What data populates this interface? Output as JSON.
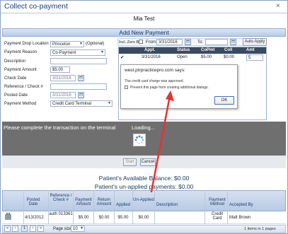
{
  "window": {
    "title": "Collect co-payment",
    "close_glyph": "×"
  },
  "patient_name": "Mia Test",
  "section_title": "Add New Payment",
  "form": {
    "drop_location": {
      "label": "Payment Drop Location",
      "value": "Princeton",
      "optional": "(Optional)"
    },
    "reason": {
      "label": "Payment Reason",
      "value": "Co-Payment"
    },
    "description": {
      "label": "Description",
      "value": ""
    },
    "amount": {
      "label": "Payment Amount",
      "value": "$5.00"
    },
    "check_date": {
      "label": "Check Date",
      "value": "3/31/2016"
    },
    "reference": {
      "label": "Reference / Check #",
      "value": ""
    },
    "posted_date": {
      "label": "Posted Date",
      "value": "3/31/2016"
    },
    "method": {
      "label": "Payment Method",
      "value": "Credit Card Terminal"
    }
  },
  "filter": {
    "incl_zero": "Incl. Zero Bal.",
    "from_label": "From:",
    "from_value": "3/31/2016",
    "to_label": "To:",
    "to_value": "",
    "auto_apply": "Auto Apply"
  },
  "appt_table": {
    "headers": [
      "Appt.",
      "Status",
      "CoPmt",
      "Coll",
      "Amt"
    ],
    "row": {
      "check": "✔",
      "date": "3/31/2016",
      "status": "Open",
      "copmt": "$5.00",
      "coll": "$0.00",
      "amt": "5"
    }
  },
  "dialog": {
    "site": "west.ptrpracticepro.com says:",
    "message": "The credit card charge was approved.",
    "prevent": "Prevent this page from creating additional dialogs.",
    "ok": "OK"
  },
  "overlay": {
    "message": "Please complete the transaction on the terminal",
    "loading": "Loading...",
    "start": "Start",
    "cancel": "Cancel"
  },
  "summary": {
    "available": "Patient's Available Balance:  $0.00",
    "unapplied": "Patient's un-applied payments:  $0.00"
  },
  "grid": {
    "headers": [
      "Posted Date",
      "Reference / Check #",
      "Payment Amount",
      "Return Amount",
      "Applied",
      "Un-Applied",
      "Description",
      "Payment Method",
      "Accepted By"
    ],
    "rows": [
      {
        "posted": "4/13/2012",
        "ref": "auth 013361",
        "amount": "$5.00",
        "ret": "$0.00",
        "applied": "$5.00",
        "unapplied": "$0.00",
        "desc": "",
        "method": "Credit Card",
        "by": "Matt Brown"
      }
    ]
  },
  "pager": {
    "page": "1",
    "page_size_label": "Page size:",
    "page_size": "10",
    "info": "1 items in 1 pages"
  },
  "colors": {
    "accent": "#17375e",
    "header_dark": "#3a4a60",
    "overlay": "#6f6f6f",
    "arrow": "#e8322f"
  }
}
